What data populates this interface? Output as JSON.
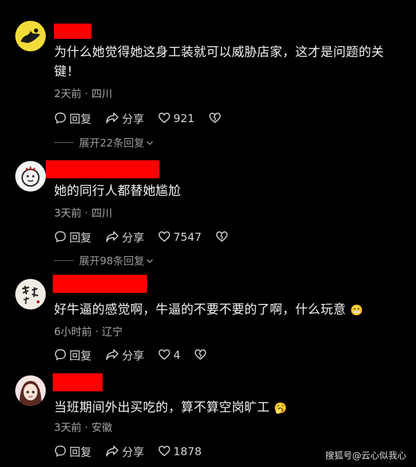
{
  "comments": [
    {
      "text": "为什么她觉得她这身工装就可以威胁店家，这才是问题的关键！",
      "meta": "2天前 · 四川",
      "reply_label": "回复",
      "share_label": "分享",
      "likes": "921",
      "expand": "展开22条回复"
    },
    {
      "text": "她的同行人都替她尴尬",
      "meta": "3天前 · 四川",
      "reply_label": "回复",
      "share_label": "分享",
      "likes": "7547",
      "expand": "展开98条回复"
    },
    {
      "text": "好牛逼的感觉啊，牛逼的不要不要的了啊，什么玩意",
      "meta": "6小时前 · 辽宁",
      "reply_label": "回复",
      "share_label": "分享",
      "likes": "4"
    },
    {
      "text": "当班期间外出买吃的，算不算空岗旷工",
      "meta": "3天前 · 安徽",
      "reply_label": "回复",
      "share_label": "分享",
      "likes": "1878"
    }
  ],
  "watermark": "搜狐号@云心似我心",
  "colors": {
    "redaction": "#ff0000",
    "background": "#000000",
    "text": "#f2f2f2",
    "meta": "#a8a8a8"
  }
}
